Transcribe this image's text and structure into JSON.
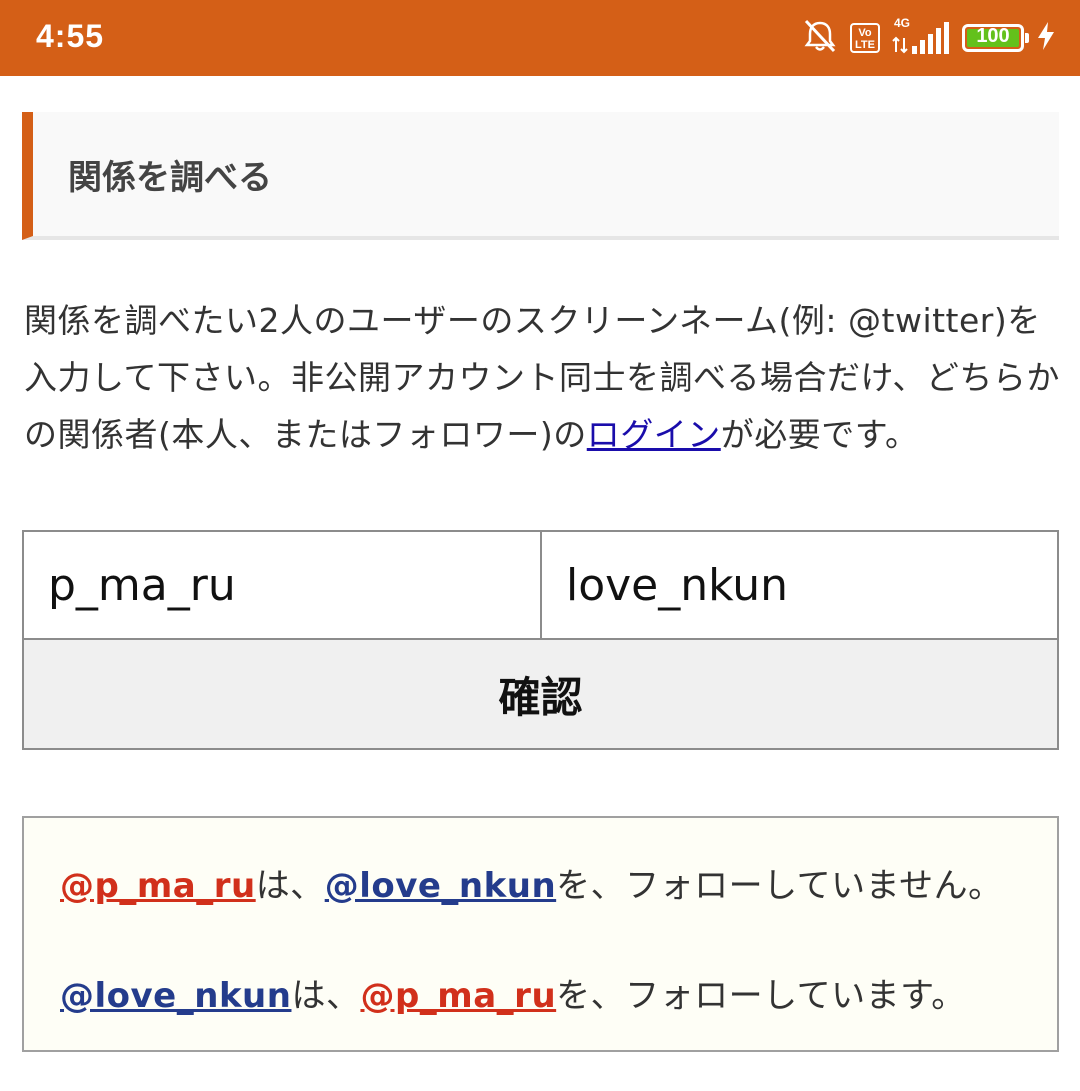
{
  "status_bar": {
    "time": "4:55",
    "icons": [
      "mute-bell-icon",
      "volte-icon",
      "signal-4g-icon",
      "battery-icon",
      "charging-icon"
    ],
    "volte_top": "Vo",
    "volte_bottom": "LTE",
    "network": "4G",
    "battery_level": "100",
    "battery_fraction": 1.0,
    "background_color": "#d45f17"
  },
  "heading": {
    "title": "関係を調べる",
    "accent_color": "#d45f17"
  },
  "description": {
    "text_before_link": "関係を調べたい2人のユーザーのスクリーンネーム(例: @twitter)を入力して下さい。非公開アカウント同士を調べる場合だけ、どちらかの関係者(本人、またはフォロワー)の",
    "link_text": "ログイン",
    "text_after_link": "が必要です。"
  },
  "form": {
    "user1_value": "p_ma_ru",
    "user2_value": "love_nkun",
    "confirm_label": "確認"
  },
  "results": [
    {
      "subject": "@p_ma_ru",
      "subject_color": "#d1301b",
      "particle": "は、",
      "object": "@love_nkun",
      "object_color": "#243c8c",
      "predicate": "を、フォローしていません。"
    },
    {
      "subject": "@love_nkun",
      "subject_color": "#243c8c",
      "particle": "は、",
      "object": "@p_ma_ru",
      "object_color": "#d1301b",
      "predicate": "を、フォローしています。"
    }
  ]
}
